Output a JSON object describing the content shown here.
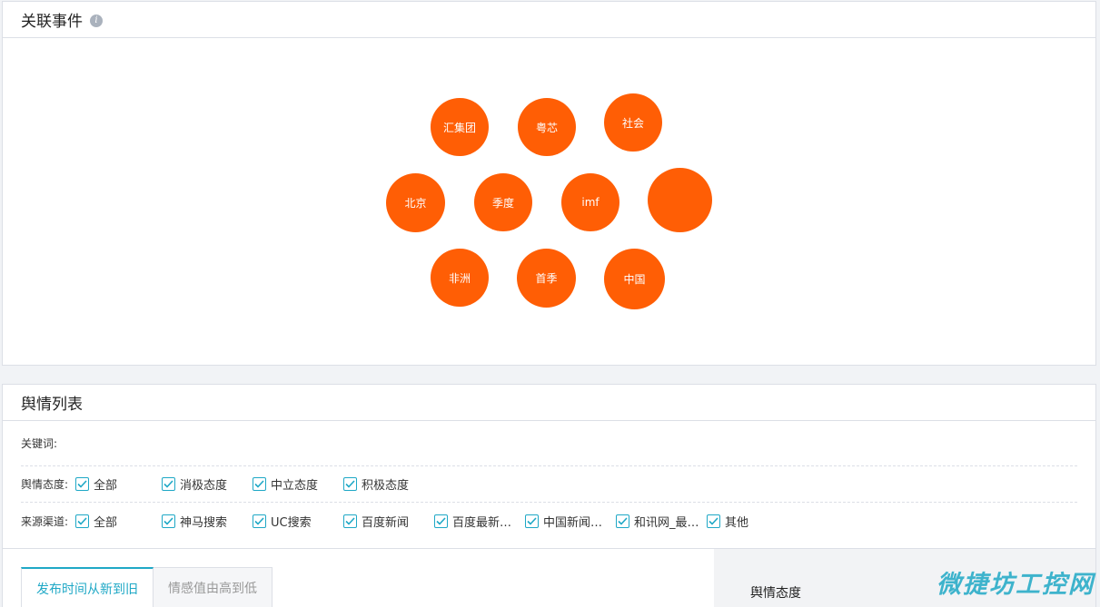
{
  "events": {
    "title": "关联事件",
    "info_icon": "i",
    "bubbles": [
      {
        "label": "汇集团"
      },
      {
        "label": "粤芯"
      },
      {
        "label": "社会"
      },
      {
        "label": "北京"
      },
      {
        "label": "季度"
      },
      {
        "label": "imf"
      },
      {
        "label": ""
      },
      {
        "label": "非洲"
      },
      {
        "label": "首季"
      },
      {
        "label": "中国"
      }
    ],
    "bubble_color": "#ff5e05"
  },
  "list": {
    "title": "舆情列表",
    "keyword_label": "关键词:",
    "sentiment_label": "舆情态度:",
    "sentiment_options": [
      "全部",
      "消极态度",
      "中立态度",
      "积极态度"
    ],
    "source_label": "来源渠道:",
    "source_options": [
      "全部",
      "神马搜索",
      "UC搜索",
      "百度新闻",
      "百度最新…",
      "中国新闻…",
      "和讯网_最…",
      "其他"
    ],
    "sort_tabs": [
      "发布时间从新到旧",
      "情感值由高到低"
    ],
    "side_title": "舆情态度",
    "accent_color": "#1fa8c6"
  },
  "watermark": "微捷坊工控网"
}
